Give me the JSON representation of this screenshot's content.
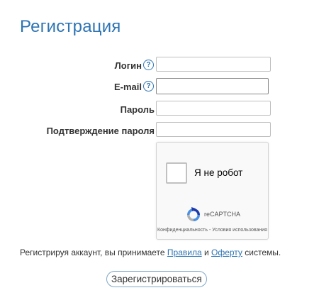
{
  "page_title": "Регистрация",
  "form": {
    "login": {
      "label": "Логин",
      "value": "",
      "help_icon": "question-circle-icon",
      "help_glyph": "?"
    },
    "email": {
      "label": "E-mail",
      "value": "",
      "help_icon": "question-circle-icon",
      "help_glyph": "?"
    },
    "password": {
      "label": "Пароль",
      "value": ""
    },
    "password_confirm": {
      "label": "Подтверждение пароля",
      "value": ""
    }
  },
  "captcha": {
    "checkbox_label": "Я не робот",
    "brand": "reCAPTCHA",
    "links": "Конфиденциальность - Условия использования",
    "icon": "recaptcha-logo-icon"
  },
  "terms": {
    "prefix": "Регистрируя аккаунт, вы принимаете ",
    "rules_link": "Правила",
    "and": " и ",
    "offer_link": "Оферту",
    "suffix": " системы."
  },
  "submit_label": "Зарегистрироваться",
  "colors": {
    "accent": "#2d74b3",
    "text": "#333333",
    "field_border": "#bfbfbf"
  }
}
